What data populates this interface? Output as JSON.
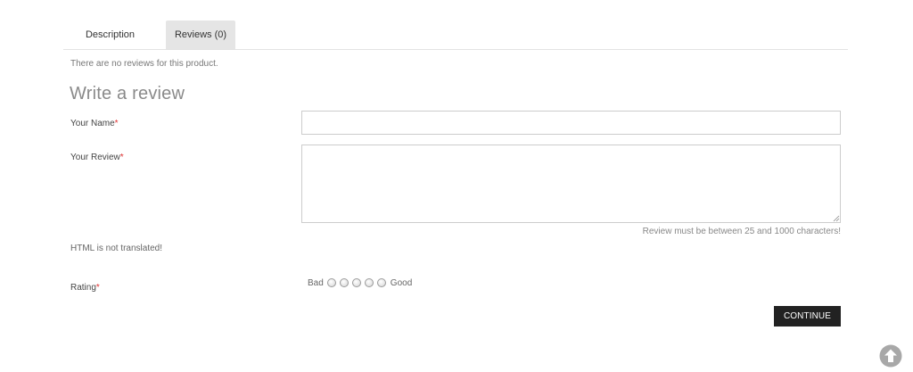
{
  "tabs": {
    "description": "Description",
    "reviews": "Reviews (0)"
  },
  "reviews": {
    "empty_message": "There are no reviews for this product."
  },
  "form": {
    "title": "Write a review",
    "name_label": "Your Name",
    "review_label": "Your Review",
    "required_marker": "*",
    "name_value": "",
    "review_value": "",
    "review_help": "Review must be between 25 and 1000 characters!",
    "html_note": "HTML is not translated!",
    "rating_label": "Rating",
    "rating_bad": "Bad",
    "rating_good": "Good",
    "rating_options": [
      "1",
      "2",
      "3",
      "4",
      "5"
    ],
    "continue_label": "CONTINUE"
  },
  "colors": {
    "required": "#e03030",
    "button_bg": "#222222",
    "active_tab_bg": "#e5e5e5",
    "scroll_top_bg": "#a8a8a8"
  },
  "icons": {
    "scroll_top": "arrow-up-circle-icon",
    "resize": "resize-grip-icon"
  }
}
